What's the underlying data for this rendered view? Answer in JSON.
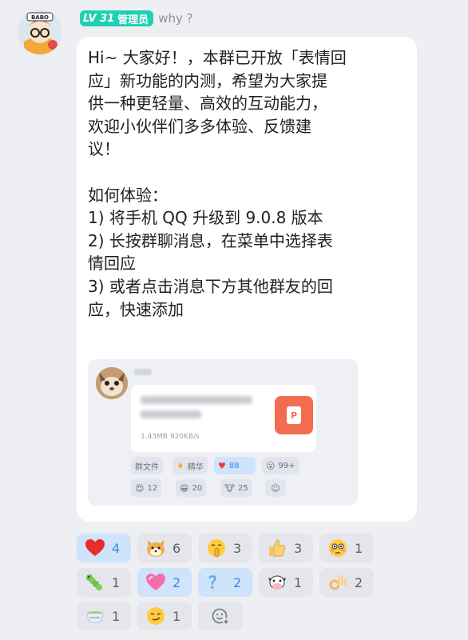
{
  "sender": {
    "level": "LV 31",
    "role": "管理员",
    "name": "why ?",
    "avatar_text": "BABO"
  },
  "message": {
    "text": "Hi~ 大家好！，本群已开放「表情回\n应」新功能的内测，希望为大家提\n供一种更轻量、高效的互动能力，\n欢迎小伙伴们多多体验、反馈建\n议！\n\n如何体验：\n1) 将手机 QQ 升级到 9.0.8 版本\n2) 长按群聊消息，在菜单中选择表\n情回应\n3) 或者点击消息下方其他群友的回\n应，快速添加",
    "preview": {
      "file_meta": "1.43MB  920KB/s",
      "file_type_letter": "P",
      "chips": [
        {
          "icon": "tag-icon",
          "label": "群文件",
          "active": false
        },
        {
          "icon": "essence-icon",
          "label": "精华",
          "active": false
        },
        {
          "icon": "heart-icon",
          "label": "88",
          "active": true
        },
        {
          "icon": "surprised-face-icon",
          "label": "99+",
          "active": false
        },
        {
          "icon": "heart-eyes-face-icon",
          "label": "12",
          "active": false
        },
        {
          "icon": "grin-face-icon",
          "label": "20",
          "active": false
        },
        {
          "icon": "cow-face-icon",
          "label": "25",
          "active": false
        },
        {
          "icon": "add-reaction-icon",
          "label": "",
          "active": false
        }
      ]
    }
  },
  "reactions": [
    {
      "icon": "red-heart-icon",
      "glyph": "❤",
      "count": "4",
      "active": true
    },
    {
      "icon": "shiba-dog-icon",
      "glyph": "🐕",
      "count": "6",
      "active": false
    },
    {
      "icon": "shushing-face-icon",
      "glyph": "🤫",
      "count": "3",
      "active": false
    },
    {
      "icon": "thumbs-up-icon",
      "glyph": "👍",
      "count": "3",
      "active": false
    },
    {
      "icon": "flushed-face-icon",
      "glyph": "😳",
      "count": "1",
      "active": false
    },
    {
      "icon": "caterpillar-icon",
      "glyph": "🐛",
      "count": "1",
      "active": false
    },
    {
      "icon": "pink-heart-icon",
      "glyph": "💗",
      "count": "2",
      "active": true
    },
    {
      "icon": "question-mark-icon",
      "glyph": "？",
      "count": "2",
      "active": true
    },
    {
      "icon": "cow-face-icon",
      "glyph": "🐮",
      "count": "1",
      "active": false
    },
    {
      "icon": "ok-hand-icon",
      "glyph": "👌",
      "count": "2",
      "active": false
    },
    {
      "icon": "tea-cup-icon",
      "glyph": "🍵",
      "count": "1",
      "active": false
    },
    {
      "icon": "smirk-face-icon",
      "glyph": "😏",
      "count": "1",
      "active": false
    }
  ],
  "colors": {
    "accent": "#3a87e8",
    "active_chip": "#cfe3fb",
    "level_badge": "#1fd0b3",
    "background": "#eeeff3"
  }
}
